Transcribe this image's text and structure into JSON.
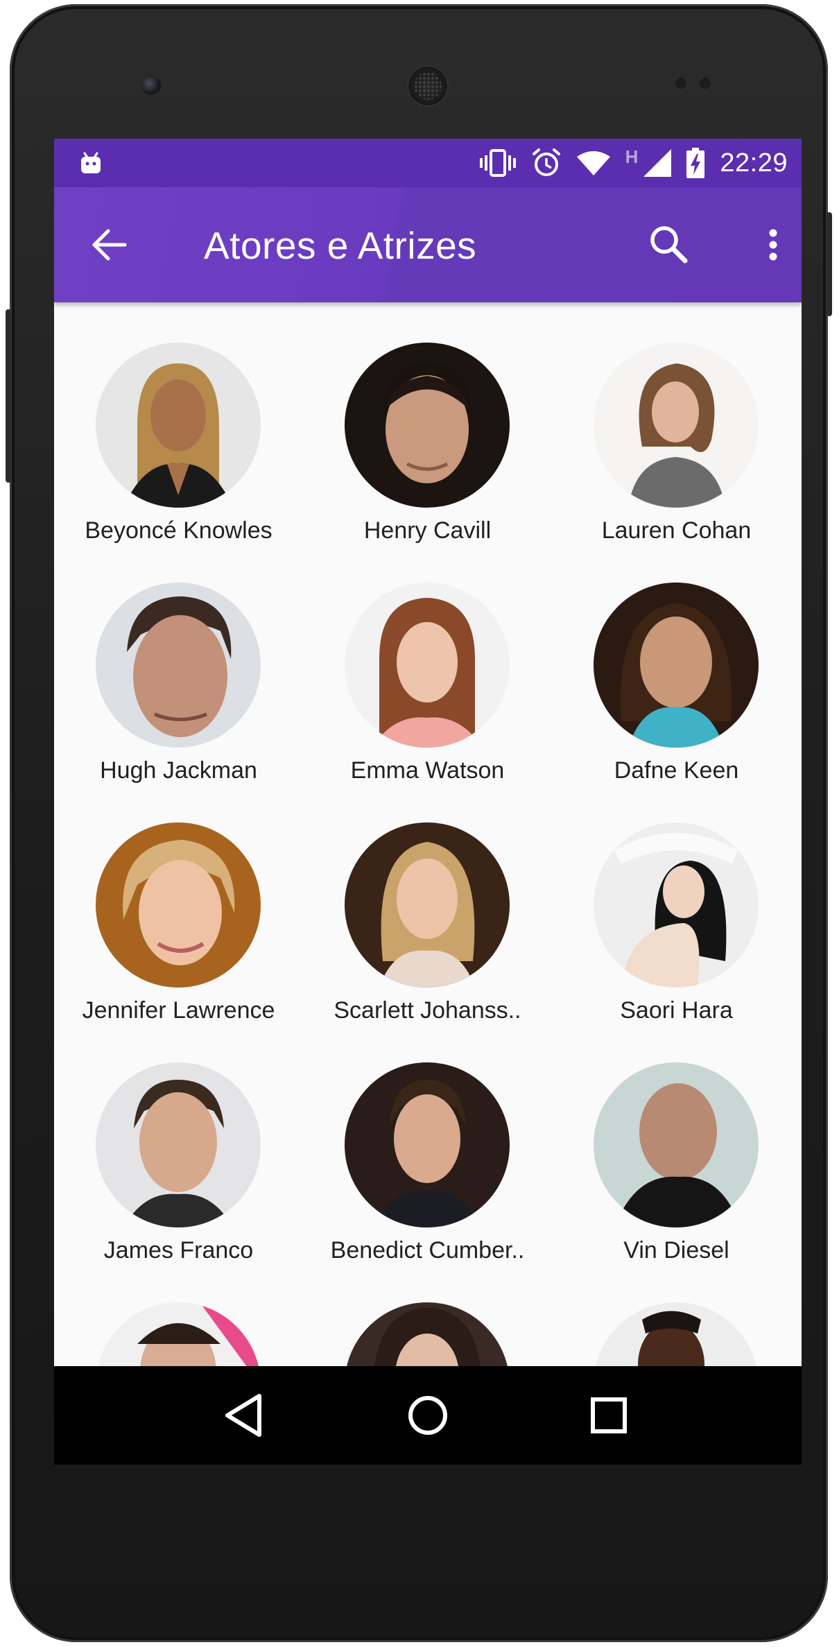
{
  "app": {
    "title": "Atores e Atrizes",
    "accent": "#673ab7",
    "status_bar_color": "#5b2eb0"
  },
  "status_bar": {
    "time": "22:29",
    "network_label": "H",
    "icons": [
      "android-debug-icon",
      "vibrate-icon",
      "alarm-icon",
      "wifi-icon",
      "signal-icon",
      "battery-charging-icon"
    ]
  },
  "toolbar": {
    "back_icon": "arrow-back-icon",
    "search_icon": "search-icon",
    "more_icon": "more-vert-icon"
  },
  "actors": [
    {
      "name": "Beyoncé Knowles"
    },
    {
      "name": "Henry Cavill"
    },
    {
      "name": "Lauren Cohan"
    },
    {
      "name": "Hugh Jackman"
    },
    {
      "name": "Emma Watson"
    },
    {
      "name": "Dafne Keen"
    },
    {
      "name": "Jennifer Lawrence"
    },
    {
      "name": "Scarlett Johanss.."
    },
    {
      "name": "Saori Hara"
    },
    {
      "name": "James Franco"
    },
    {
      "name": "Benedict Cumber.."
    },
    {
      "name": "Vin Diesel"
    },
    {
      "name": ""
    },
    {
      "name": ""
    },
    {
      "name": ""
    }
  ],
  "nav_bar": {
    "icons": [
      "back-triangle-icon",
      "home-circle-icon",
      "recents-square-icon"
    ]
  }
}
